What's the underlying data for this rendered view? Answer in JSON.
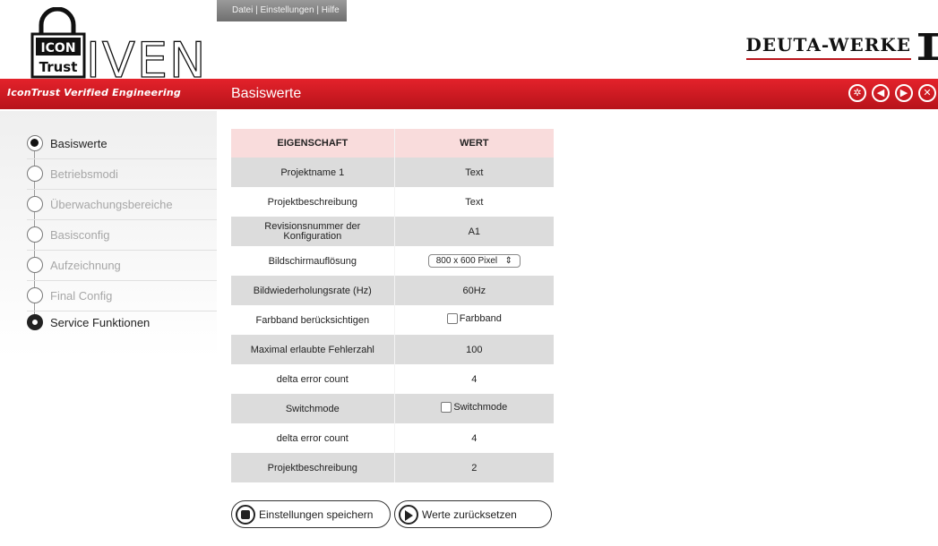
{
  "app": {
    "menu": "Datei | Einstellungen | Hilfe",
    "logo_line1": "ICON",
    "logo_line2": "Trust",
    "logo_big": "IVEN",
    "tagline": "IconTrust Verified Engineering",
    "brand": "DEUTA-WERKE",
    "page_title": "Basiswerte"
  },
  "sidebar": {
    "items": [
      {
        "label": "Basiswerte",
        "state": "active"
      },
      {
        "label": "Betriebsmodi",
        "state": "disabled"
      },
      {
        "label": "Überwachungsbereiche",
        "state": "disabled"
      },
      {
        "label": "Basisconfig",
        "state": "disabled"
      },
      {
        "label": "Aufzeichnung",
        "state": "disabled"
      },
      {
        "label": "Final Config",
        "state": "disabled"
      },
      {
        "label": "Service Funktionen",
        "state": "gear"
      }
    ]
  },
  "table": {
    "headers": [
      "EIGENSCHAFT",
      "WERT"
    ],
    "rows": [
      {
        "prop": "Projektname 1",
        "value": "Text"
      },
      {
        "prop": "Projektbeschreibung",
        "value": "Text"
      },
      {
        "prop": "Revisionsnummer der Konfiguration",
        "value": "A1"
      },
      {
        "prop": "Bildschirmauflösung",
        "value": "800 x 600 Pixel"
      },
      {
        "prop": "Bildwiederholungsrate (Hz)",
        "value": "60Hz"
      },
      {
        "prop": "Farbband berücksichtigen",
        "value": "Farbband"
      },
      {
        "prop": "Maximal erlaubte Fehlerzahl",
        "value": "100"
      },
      {
        "prop": "delta error count",
        "value": "4"
      },
      {
        "prop": "Switchmode",
        "value": "Switchmode"
      },
      {
        "prop": "delta error count",
        "value": "4"
      },
      {
        "prop": "Projektbeschreibung",
        "value": "2"
      }
    ]
  },
  "buttons": {
    "save": "Einstellungen speichern",
    "reset": "Werte zurücksetzen"
  },
  "icons": {
    "top_right": [
      "settings-icon",
      "back-icon",
      "forward-icon",
      "close-icon"
    ],
    "save_button": "save-icon",
    "reset_button": "reset-icon"
  },
  "colors": {
    "accent_red": "#d11c24",
    "header_pink": "#f9dcdc",
    "row_grey": "#dcdcdc"
  }
}
